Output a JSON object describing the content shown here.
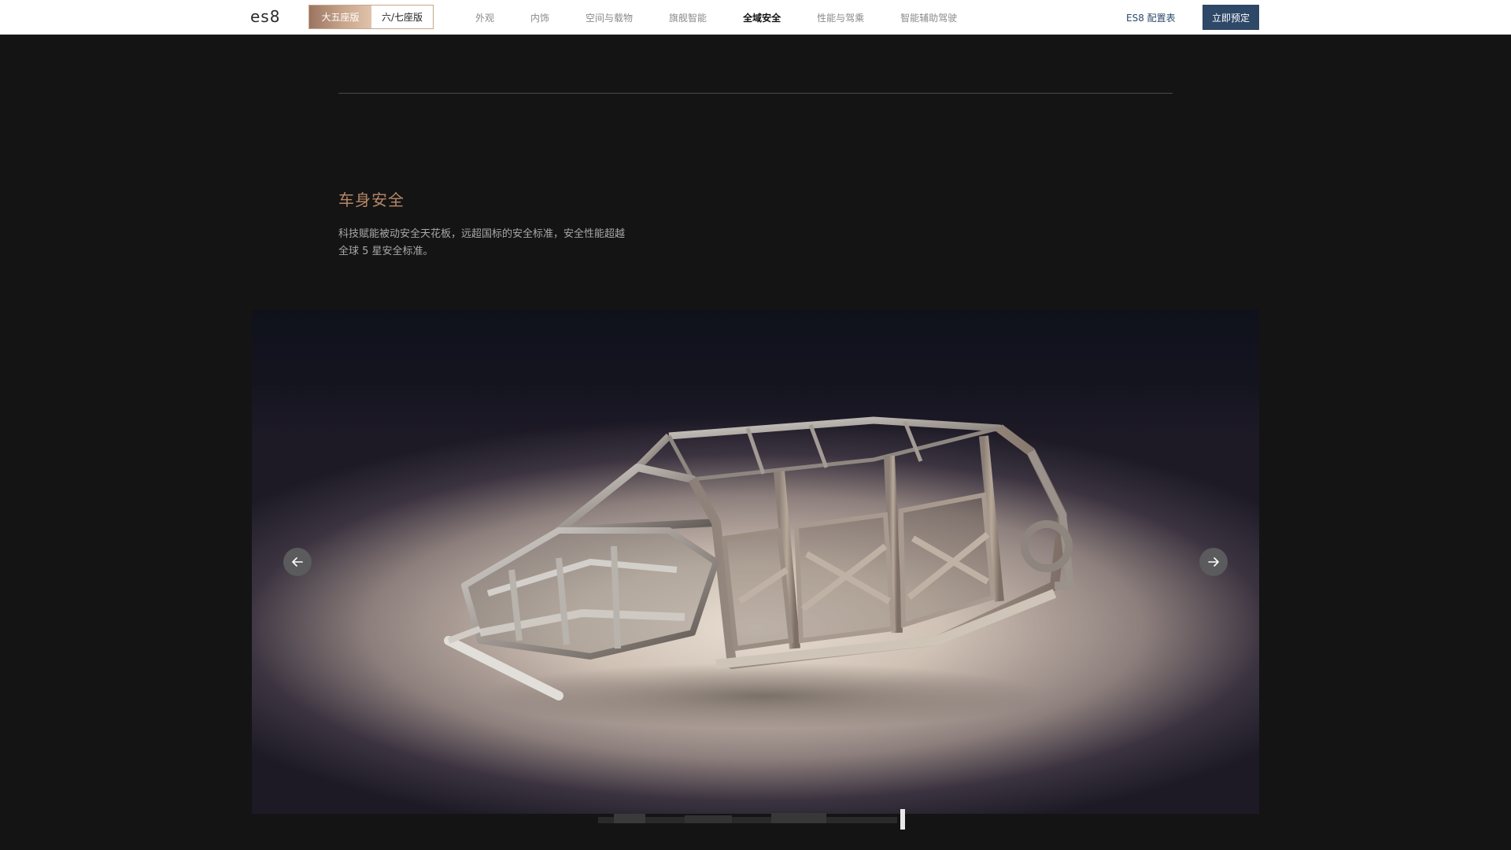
{
  "brand": {
    "logo_text": "es8"
  },
  "variant_switch": {
    "options": [
      {
        "label": "大五座版",
        "active": true
      },
      {
        "label": "六/七座版",
        "active": false
      }
    ]
  },
  "nav": {
    "links": [
      {
        "label": "外观",
        "active": false
      },
      {
        "label": "内饰",
        "active": false
      },
      {
        "label": "空间与载物",
        "active": false
      },
      {
        "label": "旗舰智能",
        "active": false
      },
      {
        "label": "全域安全",
        "active": true
      },
      {
        "label": "性能与驾乘",
        "active": false
      },
      {
        "label": "智能辅助驾驶",
        "active": false
      }
    ],
    "config_link": "ES8 配置表",
    "order_button": "立即预定"
  },
  "section": {
    "title": "车身安全",
    "description_line1": "科技赋能被动安全天花板，远超国标的安全标准，安全性能超越",
    "description_line2": "全球 5 星安全标准。"
  },
  "carousel": {
    "image_subject": "car-body-frame",
    "prev_icon": "arrow-left-icon",
    "next_icon": "arrow-right-icon"
  },
  "colors": {
    "accent_gold": "#b58768",
    "nav_blue": "#2e4868",
    "background": "#141414"
  }
}
